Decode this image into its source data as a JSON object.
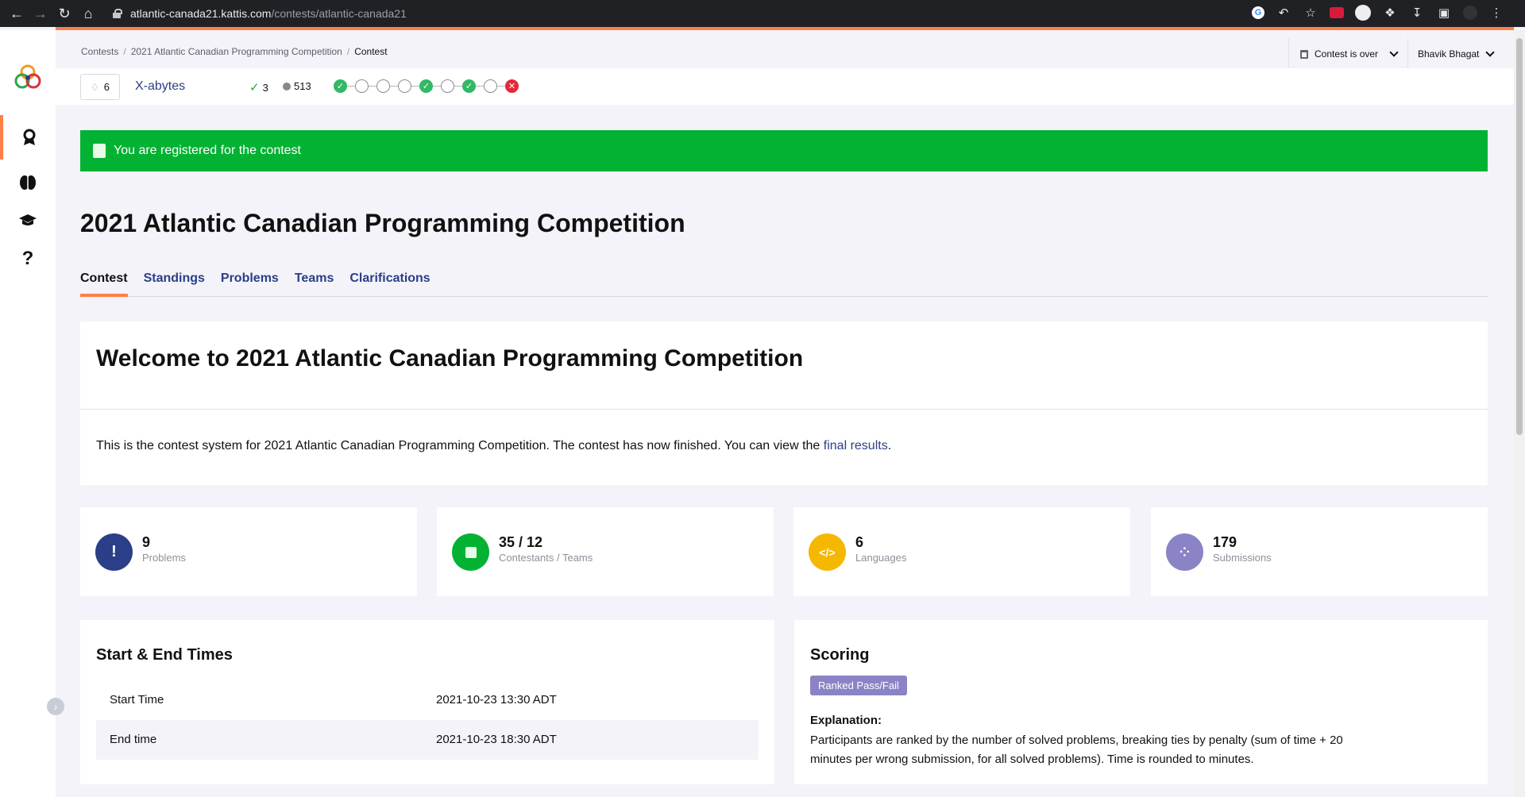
{
  "browser": {
    "url_host": "atlantic-canada21.kattis.com",
    "url_path": "/contests/atlantic-canada21"
  },
  "breadcrumb": [
    "Contests",
    "2021 Atlantic Canadian Programming Competition",
    "Contest"
  ],
  "header": {
    "contest_status": "Contest is over",
    "user_name": "Bhavik Bhagat"
  },
  "team": {
    "rank": "6",
    "name": "X-abytes",
    "solved": "3",
    "penalty": "513",
    "problems": [
      "ok",
      "none",
      "none",
      "none",
      "ok",
      "none",
      "ok",
      "none",
      "fail"
    ]
  },
  "alert": {
    "text": "You are registered for the contest"
  },
  "page": {
    "title": "2021 Atlantic Canadian Programming Competition"
  },
  "tabs": [
    "Contest",
    "Standings",
    "Problems",
    "Teams",
    "Clarifications"
  ],
  "welcome": {
    "heading": "Welcome to 2021 Atlantic Canadian Programming Competition",
    "text_before": "This is the contest system for 2021 Atlantic Canadian Programming Competition. The contest has now finished. You can view the ",
    "link": "final results",
    "text_after": "."
  },
  "stats": [
    {
      "value": "9",
      "label": "Problems",
      "icon": "exclamation-icon",
      "color": "#2a3f87"
    },
    {
      "value": "35 / 12",
      "label": "Contestants / Teams",
      "icon": "contestant-icon",
      "color": "#03b232"
    },
    {
      "value": "6",
      "label": "Languages",
      "icon": "code-icon",
      "color": "#f5b800"
    },
    {
      "value": "179",
      "label": "Submissions",
      "icon": "spinner-icon",
      "color": "#8a84c6"
    }
  ],
  "times": {
    "heading": "Start & End Times",
    "rows": [
      {
        "label": "Start Time",
        "value": "2021-10-23 13:30 ADT"
      },
      {
        "label": "End time",
        "value": "2021-10-23 18:30 ADT"
      }
    ]
  },
  "scoring": {
    "heading": "Scoring",
    "badge": "Ranked Pass/Fail",
    "explanation_heading": "Explanation:",
    "explanation": "Participants are ranked by the number of solved problems, breaking ties by penalty (sum of time + 20 minutes per wrong submission, for all solved problems). Time is rounded to minutes."
  }
}
